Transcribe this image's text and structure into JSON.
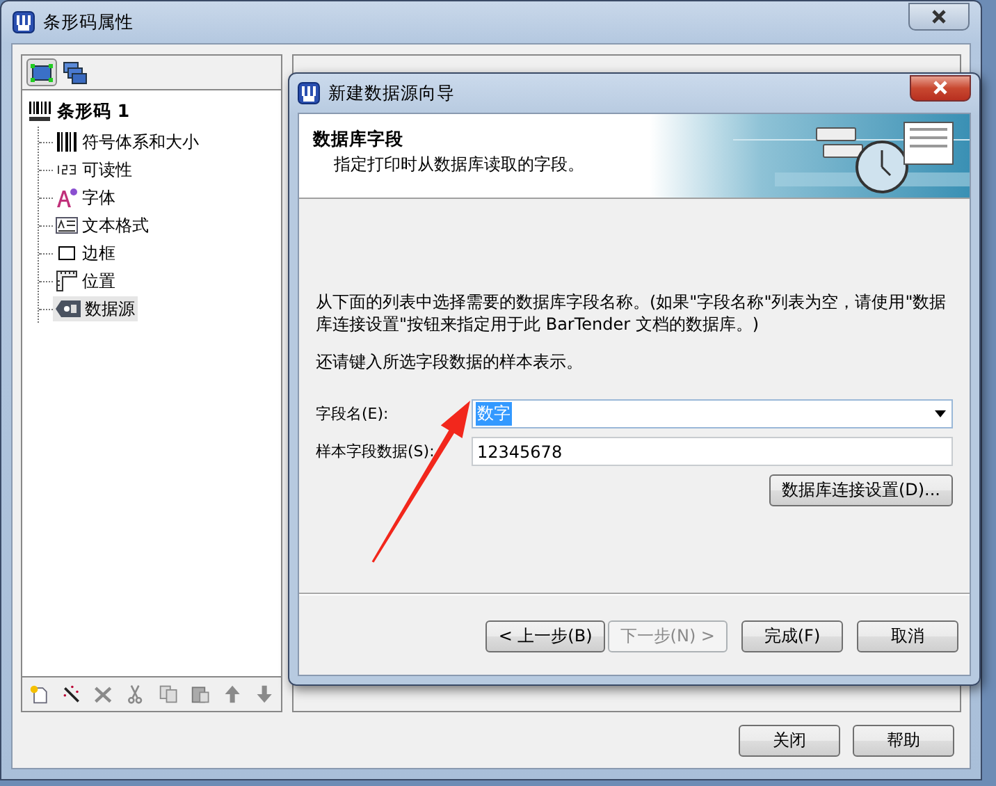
{
  "window": {
    "title": "条形码属性"
  },
  "view_toggles": [
    {
      "kind": "object",
      "selected": true
    },
    {
      "kind": "layers",
      "selected": false
    }
  ],
  "tree": {
    "label": "条形码 1",
    "kind": "barcode",
    "selected": false,
    "children": [
      {
        "label": "符号体系和大小",
        "kind": "symbology",
        "selected": false
      },
      {
        "label": "可读性",
        "kind": "readable",
        "selected": false
      },
      {
        "label": "字体",
        "kind": "font",
        "selected": false
      },
      {
        "label": "文本格式",
        "kind": "text-format",
        "selected": false
      },
      {
        "label": "边框",
        "kind": "border",
        "selected": false
      },
      {
        "label": "位置",
        "kind": "position",
        "selected": false
      },
      {
        "label": "数据源",
        "kind": "data-source",
        "selected": true
      }
    ]
  },
  "tree_toolbar": [
    {
      "kind": "new"
    },
    {
      "kind": "wizard"
    },
    {
      "kind": "delete"
    },
    {
      "kind": "cut"
    },
    {
      "kind": "copy"
    },
    {
      "kind": "paste"
    },
    {
      "kind": "up"
    },
    {
      "kind": "down"
    }
  ],
  "wizard": {
    "title": "新建数据源向导",
    "header_title": "数据库字段",
    "header_subtitle": "指定打印时从数据库读取的字段。",
    "description": "从下面的列表中选择需要的数据库字段名称。(如果\"字段名称\"列表为空，请使用\"数据库连接设置\"按钮来指定用于此 BarTender 文档的数据库。)",
    "prompt": "还请键入所选字段数据的样本表示。",
    "field_name": {
      "label": "字段名(E):",
      "value": "数字",
      "highlighted": true
    },
    "sample_data": {
      "label": "样本字段数据(S):",
      "value": "12345678"
    },
    "db_button": "数据库连接设置(D)...",
    "buttons": [
      {
        "label": "< 上一步(B)",
        "disabled": false
      },
      {
        "label": "下一步(N) >",
        "disabled": true
      },
      {
        "label": "完成(F)",
        "disabled": false
      },
      {
        "label": "取消",
        "disabled": false
      }
    ]
  },
  "buttons": [
    "关闭",
    "帮助"
  ]
}
